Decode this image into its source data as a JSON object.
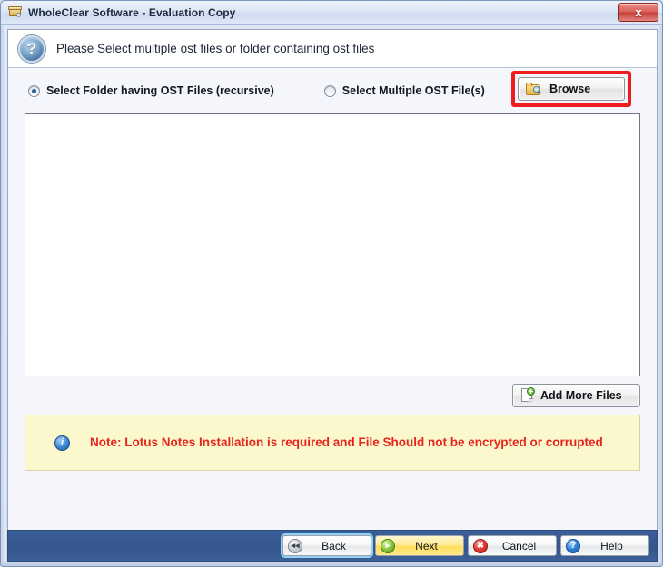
{
  "window": {
    "title": "WholeClear Software - Evaluation Copy",
    "app_icon": "box-icon",
    "close_label": "x",
    "close_icon": "close-icon"
  },
  "header": {
    "icon": "question-mark-icon",
    "icon_glyph": "?",
    "instruction": "Please Select multiple ost files or folder containing ost files"
  },
  "options": {
    "folder_option_label": "Select Folder having OST Files (recursive)",
    "folder_option_selected": true,
    "files_option_label": "Select Multiple OST File(s)",
    "files_option_selected": false,
    "browse_label": "Browse",
    "browse_icon": "folder-search-icon",
    "browse_highlight_color": "#ee1c1c"
  },
  "file_list": {
    "items": [],
    "empty": true
  },
  "actions": {
    "add_more_label": "Add More Files",
    "add_more_icon": "file-add-icon"
  },
  "note": {
    "icon": "info-icon",
    "icon_glyph": "i",
    "text": "Note: Lotus Notes Installation is required and File Should not be encrypted or corrupted",
    "text_color": "#e8231a",
    "background_color": "#fbf8cd"
  },
  "navigation": {
    "buttons": [
      {
        "label": "Back",
        "icon": "rewind-icon",
        "glyph": "◂◂",
        "style": "default",
        "focused": true
      },
      {
        "label": "Next",
        "icon": "play-icon",
        "glyph": "▸",
        "style": "next",
        "focused": false
      },
      {
        "label": "Cancel",
        "icon": "cancel-icon",
        "glyph": "✖",
        "style": "default",
        "focused": false
      },
      {
        "label": "Help",
        "icon": "help-icon",
        "glyph": "?",
        "style": "default",
        "focused": false
      }
    ]
  },
  "colors": {
    "bottom_bar": "#3b5f99",
    "client_bg": "#f4f6fb",
    "title_bar": "#dbe5f4"
  }
}
